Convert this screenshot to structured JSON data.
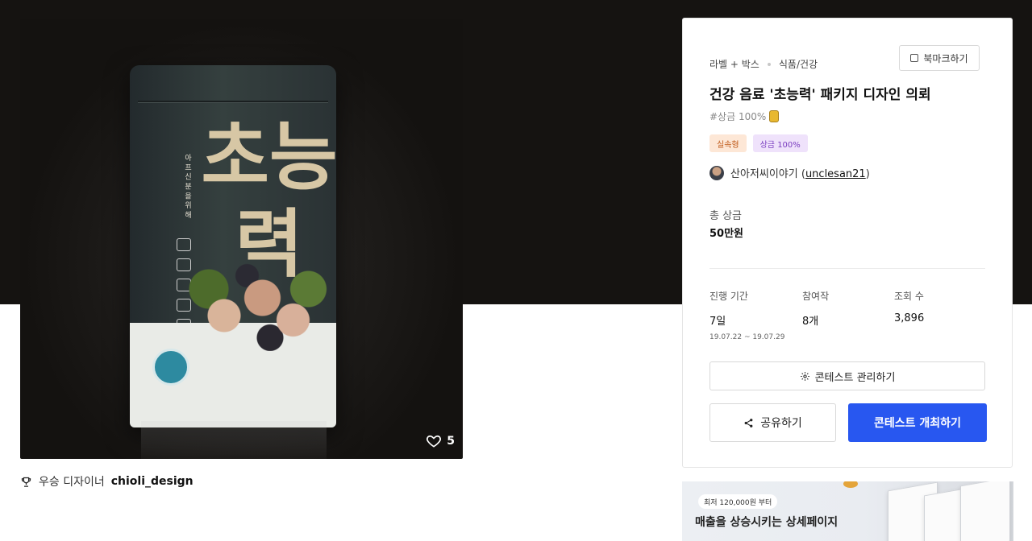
{
  "product": {
    "package_big_text": "초능력",
    "like_count": "5"
  },
  "winner": {
    "label": "우승 디자이너",
    "designer": "chioli_design"
  },
  "contest": {
    "breadcrumb": [
      "라벨 + 박스",
      "식품/건강"
    ],
    "bookmark_label": "북마크하기",
    "title": "건강 음료 '초능력' 패키지 디자인 의뢰",
    "subtitle": "#상금 100%",
    "tags": [
      "실속형",
      "상금 100%"
    ],
    "host_name": "산아저씨이야기 (",
    "host_id": "unclesan21",
    "host_close": ")",
    "prize_label": "총 상금",
    "prize_value": "50만원",
    "stats": {
      "period_label": "진행 기간",
      "period_value": "7일",
      "period_dates": "19.07.22 ~ 19.07.29",
      "entries_label": "참여작",
      "entries_value": "8개",
      "views_label": "조회 수",
      "views_value": "3,896"
    },
    "manage_label": "콘테스트 관리하기",
    "share_label": "공유하기",
    "host_button_label": "콘테스트 개최하기"
  },
  "ad": {
    "pill": "최저 120,000원 부터",
    "headline": "매출을 상승시키는 상세페이지"
  },
  "colors": {
    "hero_background": "#151311",
    "primary_button": "#2857f0",
    "tag_orange_bg": "#fde7d6",
    "tag_purple_bg": "#efe2fb"
  },
  "icons": [
    "heart-icon",
    "trophy-icon",
    "bookmark-icon",
    "gear-icon",
    "share-icon",
    "coin-icon"
  ]
}
